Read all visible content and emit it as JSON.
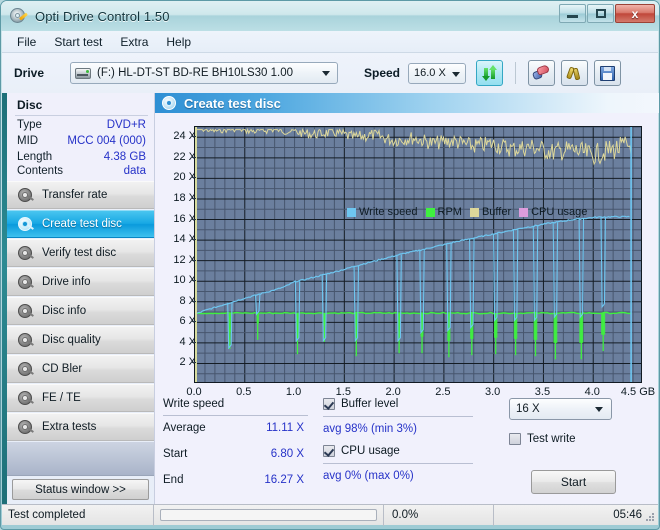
{
  "window": {
    "title": "Opti Drive Control 1.50",
    "icon": "disc-pen-icon",
    "minimize_label": "minimize",
    "maximize_label": "maximize",
    "close_label": "x"
  },
  "menu": {
    "items": [
      {
        "label": "File"
      },
      {
        "label": "Start test"
      },
      {
        "label": "Extra"
      },
      {
        "label": "Help"
      }
    ]
  },
  "toolbar": {
    "drive_label": "Drive",
    "drive_value": "(F:)  HL-DT-ST BD-RE  BH10LS30 1.00",
    "drive_icon": "optical-drive-icon",
    "speed_label": "Speed",
    "speed_value": "16.0 X",
    "refresh_icon": "refresh-icon",
    "erase_icon": "erase-disc-icon",
    "tools_icon": "tools-icon",
    "save_icon": "save-icon"
  },
  "sidebar": {
    "disc_panel": {
      "title": "Disc",
      "rows": [
        {
          "key": "Type",
          "value": "DVD+R"
        },
        {
          "key": "MID",
          "value": "MCC 004 (000)"
        },
        {
          "key": "Length",
          "value": "4.38 GB"
        },
        {
          "key": "Contents",
          "value": "data"
        }
      ]
    },
    "nav_items": [
      {
        "label": "Transfer rate",
        "icon": "disc-transfer-icon",
        "active": false
      },
      {
        "label": "Create test disc",
        "icon": "disc-write-icon",
        "active": true
      },
      {
        "label": "Verify test disc",
        "icon": "disc-verify-icon",
        "active": false
      },
      {
        "label": "Drive info",
        "icon": "disc-drive-icon",
        "active": false
      },
      {
        "label": "Disc info",
        "icon": "disc-info-icon",
        "active": false
      },
      {
        "label": "Disc quality",
        "icon": "disc-quality-icon",
        "active": false
      },
      {
        "label": "CD Bler",
        "icon": "disc-bler-icon",
        "active": false
      },
      {
        "label": "FE / TE",
        "icon": "disc-fete-icon",
        "active": false
      },
      {
        "label": "Extra tests",
        "icon": "disc-extra-icon",
        "active": false
      }
    ],
    "status_window_button": "Status window >>"
  },
  "main": {
    "panel_title": "Create test disc",
    "panel_icon": "disc-write-icon",
    "write_speed": {
      "title": "Write speed",
      "rows": [
        {
          "key": "Average",
          "value": "11.11 X"
        },
        {
          "key": "Start",
          "value": "6.80 X"
        },
        {
          "key": "End",
          "value": "16.27 X"
        }
      ]
    },
    "buffer": {
      "checkbox_label": "Buffer level",
      "checked": true,
      "value": "avg 98% (min 3%)"
    },
    "cpu": {
      "checkbox_label": "CPU usage",
      "checked": true,
      "value": "avg 0% (max 0%)"
    },
    "target_speed": "16 X",
    "test_write": {
      "label": "Test write",
      "checked": false
    },
    "start_button": "Start"
  },
  "statusbar": {
    "message": "Test completed",
    "progress_percent": 0.0,
    "progress_text": "0.0%",
    "elapsed_time": "05:46"
  },
  "colors": {
    "write_speed": "#6ec6f0",
    "rpm": "#3ff03f",
    "buffer": "#ddd79a",
    "cpu_usage": "#dd9ddd",
    "plot_bg": "#6b7f9e",
    "grid": "#2b3a45",
    "accent_blue": "#2632c8",
    "title_bar": "#cfe6eb",
    "panel_header": "#2e8fd4"
  },
  "chart_data": {
    "type": "line",
    "title": "Create test disc",
    "xlabel": "GB",
    "ylabel": "X",
    "xlim": [
      0.0,
      4.5
    ],
    "ylim": [
      0,
      25
    ],
    "grid": true,
    "legend_position": "top-left",
    "y_ticks": [
      2,
      4,
      6,
      8,
      10,
      12,
      14,
      16,
      18,
      20,
      22,
      24
    ],
    "y_tick_labels": [
      "2 X",
      "4 X",
      "6 X",
      "8 X",
      "10 X",
      "12 X",
      "14 X",
      "16 X",
      "18 X",
      "20 X",
      "22 X",
      "24 X"
    ],
    "x_ticks": [
      0.0,
      0.5,
      1.0,
      1.5,
      2.0,
      2.5,
      3.0,
      3.5,
      4.0,
      4.5
    ],
    "x_tick_labels": [
      "0.0",
      "0.5",
      "1.0",
      "1.5",
      "2.0",
      "2.5",
      "3.0",
      "3.5",
      "4.0",
      "4.5 GB"
    ],
    "legend": [
      {
        "name": "Write speed",
        "color": "#6ec6f0"
      },
      {
        "name": "RPM",
        "color": "#3ff03f"
      },
      {
        "name": "Buffer",
        "color": "#ddd79a"
      },
      {
        "name": "CPU usage",
        "color": "#dd9ddd"
      }
    ],
    "series": [
      {
        "name": "Write speed",
        "color": "#6ec6f0",
        "unit": "X",
        "axis": "left",
        "x": [
          0.0,
          0.1,
          0.2,
          0.3,
          0.4,
          0.5,
          0.6,
          0.7,
          0.8,
          0.9,
          1.0,
          1.1,
          1.2,
          1.3,
          1.4,
          1.5,
          1.6,
          1.7,
          1.8,
          1.9,
          2.0,
          2.1,
          2.2,
          2.3,
          2.4,
          2.5,
          2.6,
          2.7,
          2.8,
          2.9,
          3.0,
          3.1,
          3.2,
          3.3,
          3.4,
          3.5,
          3.6,
          3.7,
          3.8,
          3.9,
          4.0,
          4.1,
          4.2,
          4.3,
          4.38
        ],
        "values": [
          6.8,
          7.15,
          7.45,
          7.75,
          8.05,
          8.35,
          8.6,
          8.9,
          9.15,
          9.45,
          9.95,
          10.15,
          10.4,
          10.65,
          10.9,
          11.15,
          11.45,
          11.7,
          11.95,
          12.2,
          12.45,
          12.7,
          12.9,
          13.1,
          13.35,
          13.55,
          13.8,
          14.0,
          14.2,
          14.4,
          14.6,
          14.8,
          15.0,
          15.2,
          15.35,
          15.55,
          15.7,
          15.85,
          16.0,
          16.1,
          16.2,
          16.25,
          16.27,
          16.27,
          16.27
        ],
        "dropouts_x": [
          0.35,
          0.63,
          1.03,
          1.3,
          1.62,
          2.05,
          2.28,
          2.55,
          2.78,
          3.02,
          3.22,
          3.42,
          3.62,
          3.88,
          4.1
        ],
        "dropouts_min": [
          3.5,
          6.8,
          4.2,
          4.2,
          4.2,
          4.2,
          5.0,
          5.2,
          5.5,
          6.2,
          6.2,
          6.2,
          6.5,
          6.5,
          7.5
        ],
        "stats": {
          "average": 11.11,
          "start": 6.8,
          "end": 16.27
        }
      },
      {
        "name": "RPM",
        "color": "#3ff03f",
        "unit": "X",
        "axis": "left",
        "baseline": 6.9,
        "x": [
          0.0,
          0.5,
          1.0,
          1.5,
          2.0,
          2.5,
          3.0,
          3.5,
          4.0,
          4.38
        ],
        "values": [
          6.9,
          6.9,
          6.9,
          6.9,
          6.9,
          6.9,
          6.9,
          6.9,
          6.9,
          6.9
        ],
        "dropouts_x": [
          0.35,
          0.63,
          1.03,
          1.3,
          1.62,
          2.05,
          2.28,
          2.55,
          2.78,
          3.02,
          3.22,
          3.42,
          3.62,
          3.88,
          4.1
        ],
        "dropouts_min": [
          3.4,
          4.3,
          2.9,
          4.1,
          2.7,
          3.0,
          3.0,
          2.6,
          2.8,
          2.9,
          2.8,
          2.7,
          2.4,
          2.4,
          3.2
        ]
      },
      {
        "name": "Buffer",
        "color": "#ddd79a",
        "unit": "%",
        "axis": "right",
        "note": "near top of plot, 98% average with noise",
        "x": [
          0.0,
          0.2,
          0.4,
          0.6,
          0.8,
          1.0,
          1.2,
          1.4,
          1.6,
          1.8,
          2.0,
          2.2,
          2.4,
          2.6,
          2.8,
          3.0,
          3.2,
          3.4,
          3.6,
          3.8,
          4.0,
          4.2,
          4.38
        ],
        "values": [
          100,
          99,
          100,
          99,
          100,
          99,
          98,
          99,
          97,
          98,
          96,
          97,
          95,
          96,
          94,
          95,
          93,
          94,
          92,
          93,
          91,
          93,
          95
        ],
        "stats": {
          "average": 98,
          "min": 3
        }
      },
      {
        "name": "CPU usage",
        "color": "#dd9ddd",
        "unit": "%",
        "axis": "right",
        "x": [
          0.0,
          1.0,
          2.0,
          3.0,
          4.0,
          4.38
        ],
        "values": [
          0,
          0,
          0,
          0,
          0,
          0
        ],
        "stats": {
          "average": 0,
          "max": 0
        }
      }
    ]
  }
}
